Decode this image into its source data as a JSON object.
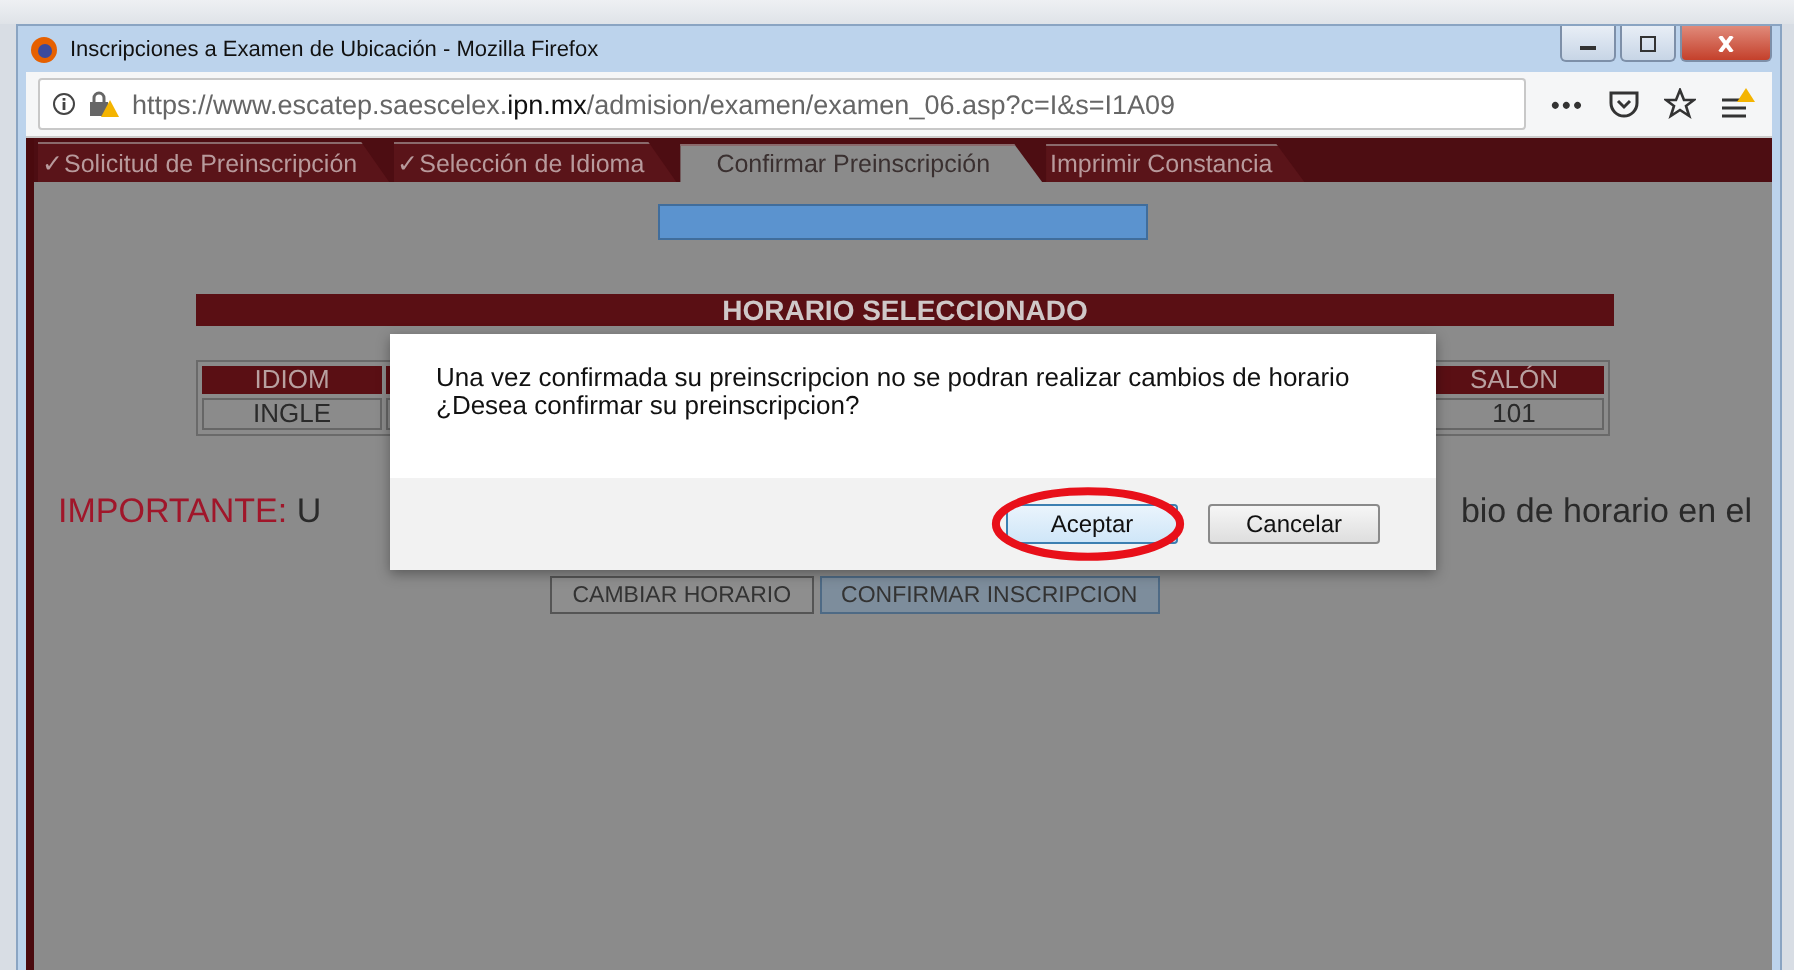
{
  "window": {
    "title": "Inscripciones a Examen de Ubicación - Mozilla Firefox"
  },
  "address_bar": {
    "url": "https://www.escatep.saescelex.**ipn.mx**/admision/examen/examen_06.asp?c=I&s=I1A09",
    "more": "•••"
  },
  "tabs": [
    {
      "label": "✓Solicitud de Preinscripción",
      "selected": false
    },
    {
      "label": "✓Selección de Idioma",
      "selected": false
    },
    {
      "label": "Confirmar Preinscripción",
      "selected": true
    },
    {
      "label": "Imprimir Constancia",
      "selected": false
    }
  ],
  "schedule": {
    "title": "HORARIO SELECCIONADO",
    "columns": [
      "IDIOM",
      "SALÓN"
    ],
    "row": [
      "INGLE",
      "101"
    ]
  },
  "notice": {
    "label": "IMPORTANTE:",
    "text_left": "U",
    "text_right": "bio de horario en el"
  },
  "buttons": [
    {
      "label": "CAMBIAR HORARIO",
      "kind": "plain"
    },
    {
      "label": "CONFIRMAR INSCRIPCION",
      "kind": "focused"
    }
  ],
  "dialog": {
    "message": [
      "Una vez confirmada su preinscripcion no se podran realizar cambios de horario",
      "¿Desea confirmar su preinscripcion?"
    ],
    "buttons": [
      {
        "label": "Aceptar",
        "kind": "default",
        "highlighted": true
      },
      {
        "label": "Cancelar",
        "kind": "plain",
        "highlighted": false
      }
    ]
  }
}
